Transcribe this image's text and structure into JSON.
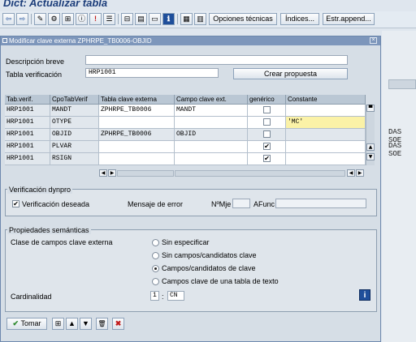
{
  "app_title": "Dict: Actualizar tabla",
  "toolbar": {
    "icon_glyphs": [
      "⇦",
      "⇨",
      "✎",
      "⚙",
      "⊞",
      "ⓘ",
      "!",
      "☰",
      "⊟",
      "▤",
      "▭",
      "ℹ",
      "▦",
      "▥"
    ],
    "opciones_label": "Opciones técnicas",
    "indices_label": "Índices...",
    "estr_append_label": "Estr.append..."
  },
  "background": {
    "label_1": "DAS SOE",
    "label_2": "DAS SOE"
  },
  "dialog": {
    "title": "Modificar clave externa ZPHRPE_TB0006-OBJID",
    "descripcion_label": "Descripción breve",
    "descripcion_value": "",
    "tabla_verif_label": "Tabla verificación",
    "tabla_verif_value": "HRP1001",
    "crear_propuesta_label": "Crear propuesta"
  },
  "grid": {
    "columns": [
      "Tab.verif.",
      "CpoTabVerif",
      "Tabla clave externa",
      "Campo clave ext.",
      "genérico",
      "Constante"
    ],
    "rows": [
      {
        "tab": "HRP1001",
        "cpo": "MANDT",
        "tabla_ext": "ZPHRPE_TB0006",
        "campo_ext": "MANDT",
        "generico": "",
        "constante": ""
      },
      {
        "tab": "HRP1001",
        "cpo": "OTYPE",
        "tabla_ext": "",
        "campo_ext": "",
        "generico": "",
        "constante": "'MC'"
      },
      {
        "tab": "HRP1001",
        "cpo": "OBJID",
        "tabla_ext": "ZPHRPE_TB0006",
        "campo_ext": "OBJID",
        "generico": "",
        "constante": ""
      },
      {
        "tab": "HRP1001",
        "cpo": "PLVAR",
        "tabla_ext": "",
        "campo_ext": "",
        "generico": "✔",
        "constante": ""
      },
      {
        "tab": "HRP1001",
        "cpo": "RSIGN",
        "tabla_ext": "",
        "campo_ext": "",
        "generico": "✔",
        "constante": ""
      }
    ]
  },
  "verificacion": {
    "group_title": "Verificación dynpro",
    "checkbox_label": "Verificación deseada",
    "checkbox_mark": "✔",
    "mensaje_label": "Mensaje de error",
    "nmje_label": "NºMje",
    "afunc_label": "AFunc"
  },
  "propiedades": {
    "group_title": "Propiedades semánticas",
    "clase_label": "Clase de campos clave externa",
    "options": [
      "Sin especificar",
      "Sin campos/candidatos clave",
      "Campos/candidatos de clave",
      "Campos clave de una tabla de texto"
    ],
    "selected_index": 2,
    "cardinalidad_label": "Cardinalidad",
    "card_left": "1",
    "card_sep": ":",
    "card_right": "CN",
    "info_glyph": "i"
  },
  "footer": {
    "tomar_label": "Tomar",
    "icon_glyphs": [
      "⊞",
      "▲",
      "▼",
      "🗑",
      "✖"
    ]
  },
  "colors": {
    "title_blue": "#1c3d7a",
    "dialog_header": "#7d96bb",
    "highlight_yellow": "#fbf2a7",
    "delete_red": "#c21b1b",
    "ok_green": "#2d8a2d"
  }
}
